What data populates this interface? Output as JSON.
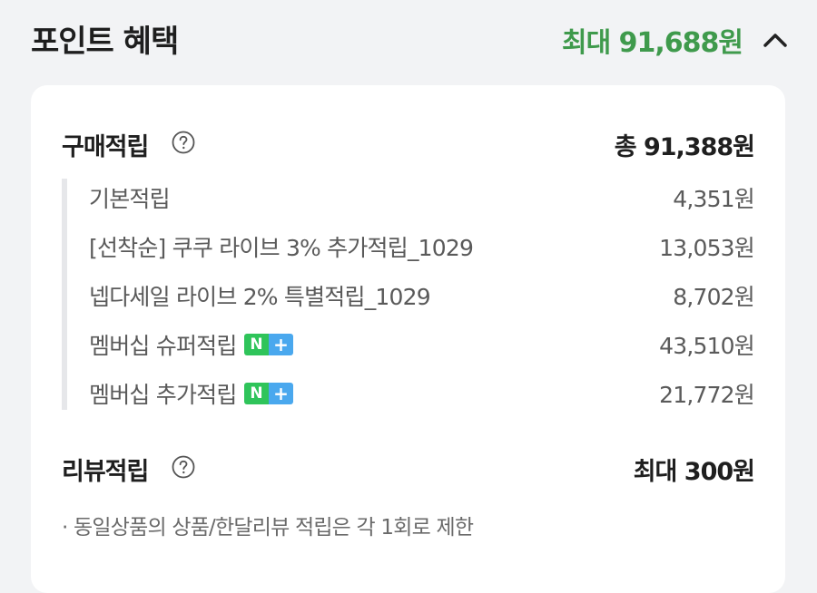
{
  "header": {
    "title": "포인트 혜택",
    "max_total": "최대 91,688원",
    "collapse_icon": "chevron-up-icon"
  },
  "purchase": {
    "title": "구매적립",
    "help_icon": "question-circle-icon",
    "total": "총 91,388원",
    "items": [
      {
        "label": "기본적립",
        "amount": "4,351원",
        "badge": false
      },
      {
        "label": "[선착순] 쿠쿠 라이브 3% 추가적립_1029",
        "amount": "13,053원",
        "badge": false
      },
      {
        "label": "넵다세일 라이브 2% 특별적립_1029",
        "amount": "8,702원",
        "badge": false
      },
      {
        "label": "멤버십 슈퍼적립",
        "amount": "43,510원",
        "badge": true
      },
      {
        "label": "멤버십 추가적립",
        "amount": "21,772원",
        "badge": true
      }
    ],
    "badge": {
      "n": "N",
      "plus": "+"
    }
  },
  "review": {
    "title": "리뷰적립",
    "help_icon": "question-circle-icon",
    "total": "최대 300원",
    "note": "· 동일상품의 상품/한달리뷰 적립은 각 1회로 제한"
  },
  "colors": {
    "accent_green": "#3f9a4c",
    "badge_green": "#2fc45a",
    "badge_blue": "#4aa8ee",
    "background": "#f2f3f5",
    "card": "#ffffff"
  }
}
